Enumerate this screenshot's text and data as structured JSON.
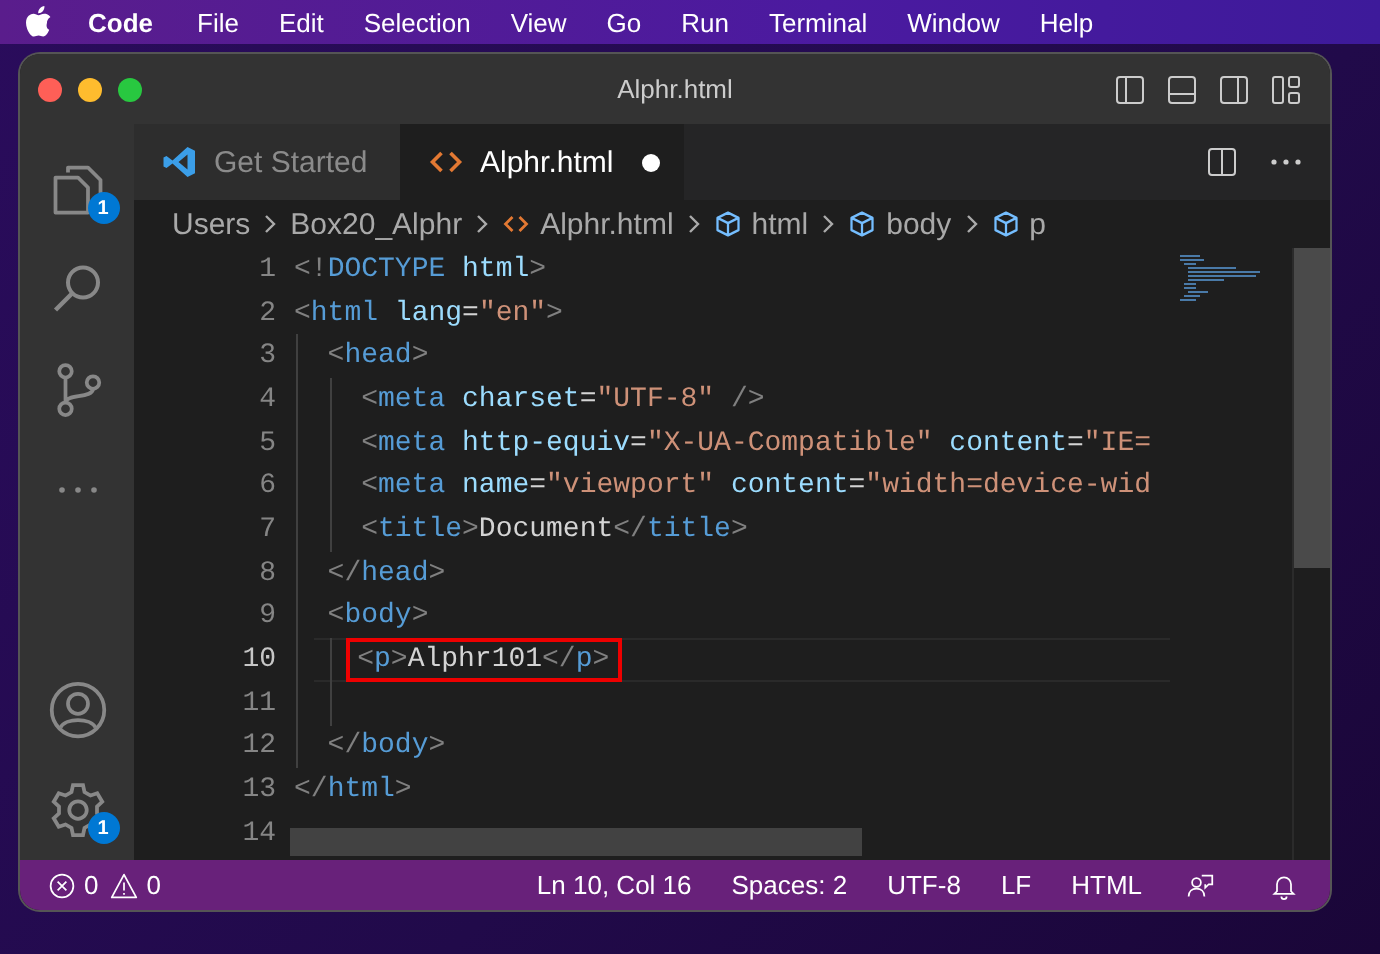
{
  "menu_bar": {
    "app": "Code",
    "items": [
      "File",
      "Edit",
      "Selection",
      "View",
      "Go",
      "Run",
      "Terminal",
      "Window",
      "Help"
    ]
  },
  "window": {
    "title": "Alphr.html"
  },
  "activity_bar": [
    {
      "kind": "explorer",
      "badge": "1"
    },
    {
      "kind": "search"
    },
    {
      "kind": "source-control"
    },
    {
      "kind": "more"
    },
    {
      "kind": "account"
    },
    {
      "kind": "settings",
      "badge": "1"
    }
  ],
  "tabs": [
    {
      "label": "Get Started",
      "kind": "welcome",
      "selected": false,
      "dirty": false
    },
    {
      "label": "Alphr.html",
      "kind": "html",
      "selected": true,
      "dirty": true
    }
  ],
  "breadcrumbs": [
    {
      "label": "Users",
      "kind": "folder"
    },
    {
      "label": "Box20_Alphr",
      "kind": "folder"
    },
    {
      "label": "Alphr.html",
      "kind": "file"
    },
    {
      "label": "html",
      "kind": "element"
    },
    {
      "label": "body",
      "kind": "element"
    },
    {
      "label": "p",
      "kind": "element"
    }
  ],
  "lines": [
    {
      "number": "1",
      "current": false,
      "boxed": false,
      "tokens": [
        {
          "kind": "punct",
          "t": "<!"
        },
        {
          "kind": "tag",
          "t": "DOCTYPE"
        },
        {
          "kind": "attr",
          "t": " html"
        },
        {
          "kind": "punct",
          "t": ">"
        }
      ]
    },
    {
      "number": "2",
      "current": false,
      "boxed": false,
      "tokens": [
        {
          "kind": "punct",
          "t": "<"
        },
        {
          "kind": "tag",
          "t": "html"
        },
        {
          "kind": "attr",
          "t": " lang"
        },
        {
          "kind": "text",
          "t": "="
        },
        {
          "kind": "string",
          "t": "\"en\""
        },
        {
          "kind": "punct",
          "t": ">"
        }
      ],
      "children": [
        {
          "number": "3",
          "current": false,
          "boxed": false,
          "tokens": [
            {
              "kind": "punct",
              "t": "<"
            },
            {
              "kind": "tag",
              "t": "head"
            },
            {
              "kind": "punct",
              "t": ">"
            }
          ],
          "children": [
            {
              "number": "4",
              "current": false,
              "boxed": false,
              "tokens": [
                {
                  "kind": "punct",
                  "t": "<"
                },
                {
                  "kind": "tag",
                  "t": "meta"
                },
                {
                  "kind": "attr",
                  "t": " charset"
                },
                {
                  "kind": "text",
                  "t": "="
                },
                {
                  "kind": "string",
                  "t": "\"UTF-8\""
                },
                {
                  "kind": "punct",
                  "t": " />"
                }
              ]
            },
            {
              "number": "5",
              "current": false,
              "boxed": false,
              "tokens": [
                {
                  "kind": "punct",
                  "t": "<"
                },
                {
                  "kind": "tag",
                  "t": "meta"
                },
                {
                  "kind": "attr",
                  "t": " http-equiv"
                },
                {
                  "kind": "text",
                  "t": "="
                },
                {
                  "kind": "string",
                  "t": "\"X-UA-Compatible\""
                },
                {
                  "kind": "attr",
                  "t": " content"
                },
                {
                  "kind": "text",
                  "t": "="
                },
                {
                  "kind": "string",
                  "t": "\"IE="
                }
              ]
            },
            {
              "number": "6",
              "current": false,
              "boxed": false,
              "tokens": [
                {
                  "kind": "punct",
                  "t": "<"
                },
                {
                  "kind": "tag",
                  "t": "meta"
                },
                {
                  "kind": "attr",
                  "t": " name"
                },
                {
                  "kind": "text",
                  "t": "="
                },
                {
                  "kind": "string",
                  "t": "\"viewport\""
                },
                {
                  "kind": "attr",
                  "t": " content"
                },
                {
                  "kind": "text",
                  "t": "="
                },
                {
                  "kind": "string",
                  "t": "\"width=device-wid"
                }
              ]
            },
            {
              "number": "7",
              "current": false,
              "boxed": false,
              "tokens": [
                {
                  "kind": "punct",
                  "t": "<"
                },
                {
                  "kind": "tag",
                  "t": "title"
                },
                {
                  "kind": "punct",
                  "t": ">"
                },
                {
                  "kind": "text",
                  "t": "Document"
                },
                {
                  "kind": "punct",
                  "t": "</"
                },
                {
                  "kind": "tag",
                  "t": "title"
                },
                {
                  "kind": "punct",
                  "t": ">"
                }
              ]
            }
          ]
        },
        {
          "number": "8",
          "current": false,
          "boxed": false,
          "tokens": [
            {
              "kind": "punct",
              "t": "</"
            },
            {
              "kind": "tag",
              "t": "head"
            },
            {
              "kind": "punct",
              "t": ">"
            }
          ]
        },
        {
          "number": "9",
          "current": false,
          "boxed": false,
          "tokens": [
            {
              "kind": "punct",
              "t": "<"
            },
            {
              "kind": "tag",
              "t": "body"
            },
            {
              "kind": "punct",
              "t": ">"
            }
          ],
          "children": [
            {
              "number": "10",
              "current": true,
              "boxed": true,
              "tokens": [
                {
                  "kind": "punct",
                  "t": "<"
                },
                {
                  "kind": "tag",
                  "t": "p"
                },
                {
                  "kind": "punct",
                  "t": ">"
                },
                {
                  "kind": "text",
                  "t": "Alphr101"
                },
                {
                  "kind": "punct",
                  "t": "</"
                },
                {
                  "kind": "tag",
                  "t": "p"
                },
                {
                  "kind": "punct",
                  "t": ">"
                }
              ]
            },
            {
              "number": "11",
              "current": false,
              "boxed": false
            }
          ]
        },
        {
          "number": "12",
          "current": false,
          "boxed": false,
          "tokens": [
            {
              "kind": "punct",
              "t": "</"
            },
            {
              "kind": "tag",
              "t": "body"
            },
            {
              "kind": "punct",
              "t": ">"
            }
          ]
        }
      ]
    },
    {
      "number": "13",
      "current": false,
      "boxed": false,
      "tokens": [
        {
          "kind": "punct",
          "t": "</"
        },
        {
          "kind": "tag",
          "t": "html"
        },
        {
          "kind": "punct",
          "t": ">"
        }
      ]
    },
    {
      "number": "14",
      "current": false,
      "boxed": false
    }
  ],
  "status_bar": {
    "errors": "0",
    "warnings": "0",
    "items": [
      "Ln 10, Col 16",
      "Spaces: 2",
      "UTF-8",
      "LF",
      "HTML"
    ]
  }
}
